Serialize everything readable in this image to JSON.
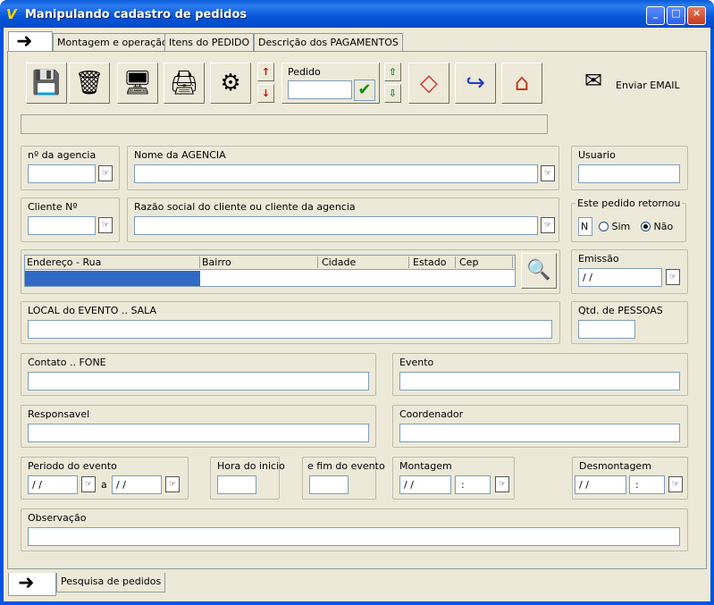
{
  "window": {
    "title": "Manipulando cadastro de pedidos",
    "icon_glyph": "V"
  },
  "tabs": [
    {
      "label": "Montagem e operação"
    },
    {
      "label": "Itens do PEDIDO"
    },
    {
      "label": "Descrição dos PAGAMENTOS"
    }
  ],
  "toolbar": {
    "pedido_label": "Pedido",
    "pedido_value": "",
    "email_label": "Enviar EMAIL",
    "arrow_up": "↑",
    "arrow_down": "↓"
  },
  "form": {
    "agencia_num_label": "nº da agencia",
    "agencia_nome_label": "Nome da AGENCIA",
    "usuario_label": "Usuario",
    "cliente_num_label": "Cliente Nº",
    "razao_label": "Razão social do cliente ou cliente da agencia",
    "retornou_label": "Este pedido retornou",
    "retornou_value": "N",
    "sim_label": "Sim",
    "nao_label": "Não",
    "endereco_cols": [
      "Endereço - Rua",
      "Bairro",
      "Cidade",
      "Estado",
      "Cep"
    ],
    "emissao_label": "Emissão",
    "emissao_value": "/ /",
    "local_label": "LOCAL do EVENTO .. SALA",
    "qtd_label": "Qtd. de PESSOAS",
    "contato_label": "Contato .. FONE",
    "evento_label": "Evento",
    "responsavel_label": "Responsavel",
    "coordenador_label": "Coordenador",
    "periodo_label": "Periodo do evento",
    "periodo_de": "/ /",
    "periodo_a_label": "a",
    "periodo_ate": "/ /",
    "hora_inicio_label": "Hora do inicio",
    "hora_fim_label": "e fim do evento",
    "montagem_label": "Montagem",
    "montagem_date": "/ /",
    "montagem_time": ":",
    "desmontagem_label": "Desmontagem",
    "desmontagem_date": "/ /",
    "desmontagem_time": ":",
    "observacao_label": "Observação"
  },
  "bottom_tab": {
    "label": "Pesquisa de pedidos"
  },
  "colors": {
    "selection": "#316ac5",
    "title_bar": "#0054e3",
    "face": "#ece9d8"
  }
}
